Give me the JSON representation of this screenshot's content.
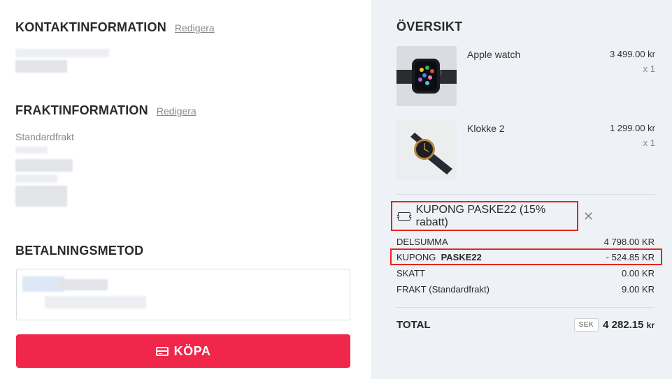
{
  "contact": {
    "title": "KONTAKTINFORMATION",
    "edit": "Redigera"
  },
  "shipping": {
    "title": "FRAKTINFORMATION",
    "edit": "Redigera",
    "method": "Standardfrakt"
  },
  "payment": {
    "title": "BETALNINGSMETOD"
  },
  "buy_button": {
    "label": "KÖPA",
    "icon": "credit-card-icon"
  },
  "overview": {
    "title": "ÖVERSIKT",
    "items": [
      {
        "name": "Apple watch",
        "price": "3 499.00 kr",
        "qty": "x 1",
        "image": "apple-watch-image"
      },
      {
        "name": "Klokke 2",
        "price": "1 299.00 kr",
        "qty": "x 1",
        "image": "wrist-watch-image"
      }
    ],
    "coupon": {
      "label": "KUPONG PASKE22 (15% rabatt)",
      "icon": "ticket-icon",
      "remove_icon": "close-icon"
    },
    "summary": {
      "subtotal": {
        "label": "DELSUMMA",
        "value": "4 798.00 KR"
      },
      "coupon": {
        "label": "KUPONG",
        "code": "PASKE22",
        "value": "- 524.85 KR"
      },
      "tax": {
        "label": "SKATT",
        "value": "0.00 KR"
      },
      "shipping": {
        "label": "FRAKT",
        "note": "(Standardfrakt)",
        "value": "9.00 KR"
      }
    },
    "total": {
      "label": "TOTAL",
      "currency": "SEK",
      "value": "4 282.15",
      "unit": "kr"
    }
  },
  "colors": {
    "accent": "#f0264a",
    "highlight": "#e4271b",
    "panel": "#eef1f5"
  }
}
